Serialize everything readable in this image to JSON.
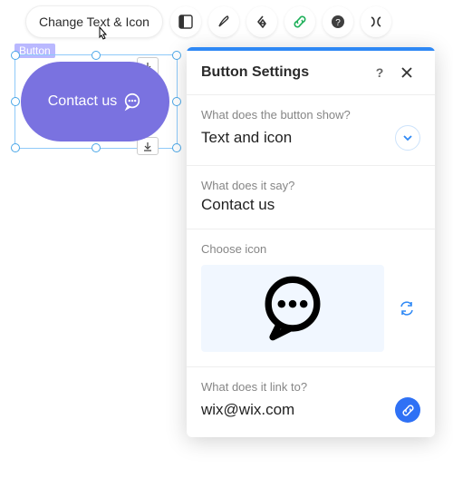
{
  "toolbar": {
    "label": "Change Text & Icon"
  },
  "selection": {
    "tag": "Button",
    "preview_text": "Contact us"
  },
  "panel": {
    "title": "Button Settings",
    "section_show": {
      "label": "What does the button show?",
      "value": "Text and icon"
    },
    "section_text": {
      "label": "What does it say?",
      "value": "Contact us"
    },
    "section_icon": {
      "label": "Choose icon"
    },
    "section_link": {
      "label": "What does it link to?",
      "value": "wix@wix.com"
    }
  }
}
